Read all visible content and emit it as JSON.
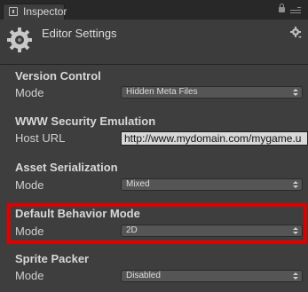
{
  "window": {
    "tab_label": "Inspector",
    "title": "Editor Settings"
  },
  "sections": [
    {
      "title": "Version Control",
      "rows": [
        {
          "label": "Mode",
          "value": "Hidden Meta Files",
          "type": "dropdown"
        }
      ]
    },
    {
      "title": "WWW Security Emulation",
      "rows": [
        {
          "label": "Host URL",
          "value": "http://www.mydomain.com/mygame.u",
          "type": "text"
        }
      ]
    },
    {
      "title": "Asset Serialization",
      "rows": [
        {
          "label": "Mode",
          "value": "Mixed",
          "type": "dropdown"
        }
      ]
    },
    {
      "title": "Default Behavior Mode",
      "rows": [
        {
          "label": "Mode",
          "value": "2D",
          "type": "dropdown"
        }
      ],
      "highlighted": true
    },
    {
      "title": "Sprite Packer",
      "rows": [
        {
          "label": "Mode",
          "value": "Disabled",
          "type": "dropdown"
        }
      ]
    }
  ],
  "icons": {
    "tab": "inspector-icon",
    "header": "gear-icon",
    "settings": "settings-gear-icon",
    "lock": "lock-icon",
    "menu": "menu-icon"
  },
  "colors": {
    "background": "#3e3e3e",
    "highlight": "#e00000"
  }
}
